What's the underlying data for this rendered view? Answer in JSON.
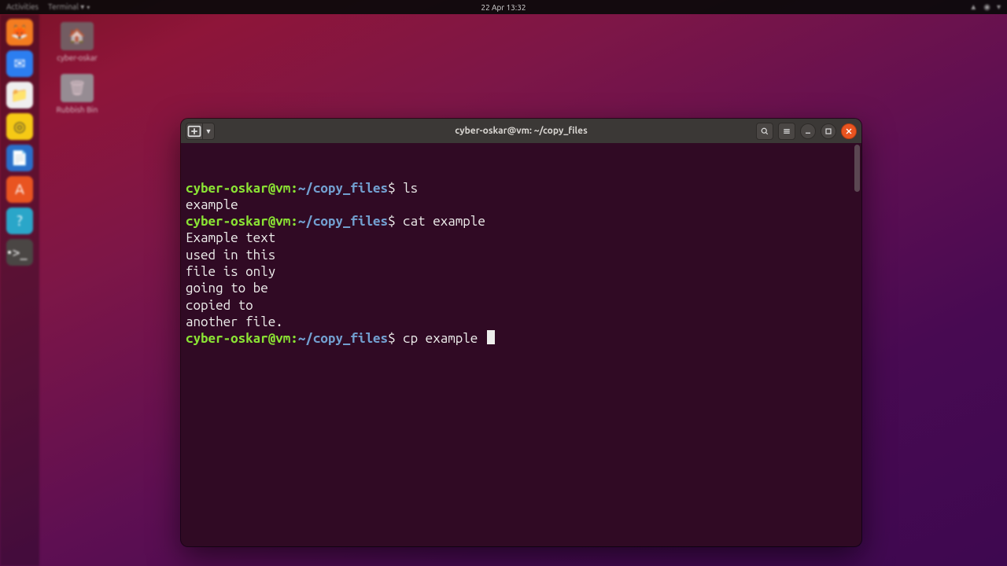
{
  "topbar": {
    "left_activities": "Activities",
    "left_app": "Terminal ▾",
    "clock": "22 Apr  13:32"
  },
  "desktop": {
    "icon1_label": "cyber-oskar",
    "icon2_label": "Rubbish Bin"
  },
  "terminal": {
    "title": "cyber-oskar@vm: ~/copy_files",
    "prompt_user": "cyber-oskar@vm",
    "prompt_path": "~/copy_files",
    "prompt_sym": "$",
    "lines": {
      "cmd1": "ls",
      "out1": "example",
      "cmd2": "cat example",
      "out2a": "Example text",
      "out2b": "used in this",
      "out2c": "file is only",
      "out2d": "going to be",
      "out2e": "copied to",
      "out2f": "another file.",
      "cmd3": "cp example "
    }
  }
}
